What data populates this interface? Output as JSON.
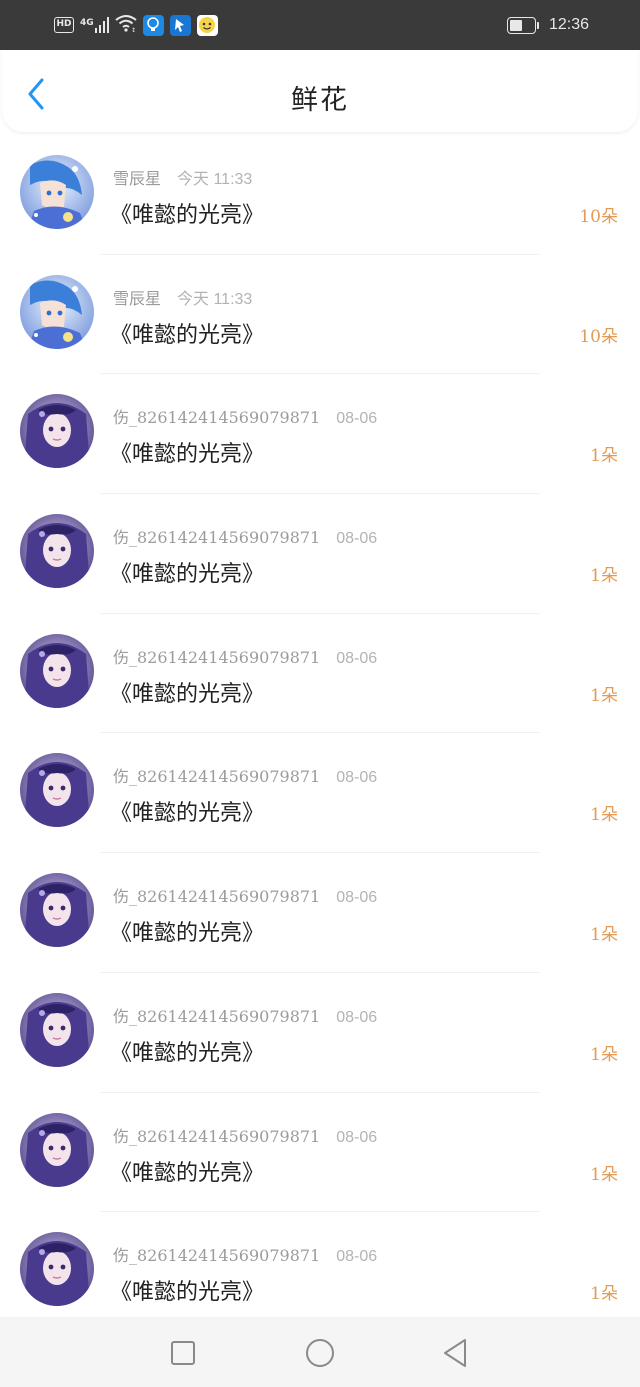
{
  "status_bar": {
    "hd_label": "HD",
    "network_label": "4G",
    "time": "12:36",
    "battery_level": 0.55
  },
  "header": {
    "title": "鲜花",
    "back_icon": "chevron-left-icon"
  },
  "list": {
    "items": [
      {
        "name": "雪辰星",
        "date": "今天  11:33",
        "book": "《唯懿的光亮》",
        "count": "10朵",
        "avatar": "anime-girl-blue"
      },
      {
        "name": "雪辰星",
        "date": "今天  11:33",
        "book": "《唯懿的光亮》",
        "count": "10朵",
        "avatar": "anime-girl-blue"
      },
      {
        "name": "伤_826142414569079871",
        "date": "08-06",
        "book": "《唯懿的光亮》",
        "count": "1朵",
        "avatar": "anime-girl-purple"
      },
      {
        "name": "伤_826142414569079871",
        "date": "08-06",
        "book": "《唯懿的光亮》",
        "count": "1朵",
        "avatar": "anime-girl-purple"
      },
      {
        "name": "伤_826142414569079871",
        "date": "08-06",
        "book": "《唯懿的光亮》",
        "count": "1朵",
        "avatar": "anime-girl-purple"
      },
      {
        "name": "伤_826142414569079871",
        "date": "08-06",
        "book": "《唯懿的光亮》",
        "count": "1朵",
        "avatar": "anime-girl-purple"
      },
      {
        "name": "伤_826142414569079871",
        "date": "08-06",
        "book": "《唯懿的光亮》",
        "count": "1朵",
        "avatar": "anime-girl-purple"
      },
      {
        "name": "伤_826142414569079871",
        "date": "08-06",
        "book": "《唯懿的光亮》",
        "count": "1朵",
        "avatar": "anime-girl-purple"
      },
      {
        "name": "伤_826142414569079871",
        "date": "08-06",
        "book": "《唯懿的光亮》",
        "count": "1朵",
        "avatar": "anime-girl-purple"
      },
      {
        "name": "伤_826142414569079871",
        "date": "08-06",
        "book": "《唯懿的光亮》",
        "count": "1朵",
        "avatar": "anime-girl-purple"
      }
    ]
  },
  "nav_bar": {
    "buttons": [
      "recent-apps-icon",
      "home-icon",
      "back-icon"
    ]
  },
  "colors": {
    "status_bar_bg": "#3a3a3a",
    "accent_back": "#2196f3",
    "count_color": "#e39a54",
    "meta_color": "#9b9b9b",
    "title_color": "#222222"
  }
}
